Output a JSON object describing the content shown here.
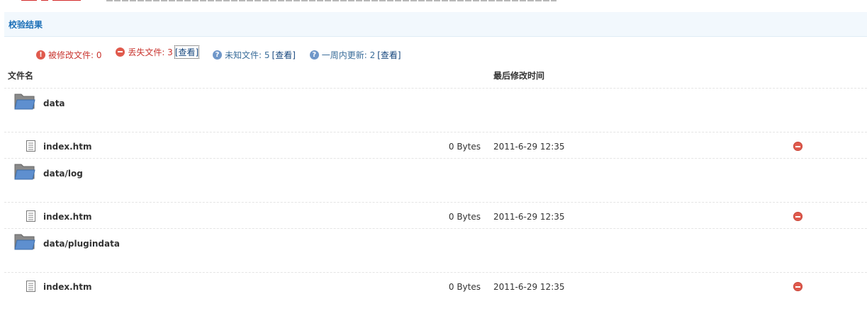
{
  "colors": {
    "accent_blue": "#1b6fb7",
    "header_bg": "#f2f8fd",
    "error_red": "#e05a4d",
    "info_blue": "#6f97c9"
  },
  "section": {
    "title": "校验结果"
  },
  "summary": {
    "modified": {
      "label": "被修改文件: 0",
      "icon": "exclamation-icon"
    },
    "missing": {
      "label": "丢失文件: 3",
      "link": "[查看]",
      "icon": "minus-circle-icon"
    },
    "unknown": {
      "label": "未知文件: 5",
      "link": "[查看]",
      "icon": "question-icon"
    },
    "recent": {
      "label": "一周内更新: 2",
      "link": "[查看]",
      "icon": "question-icon"
    }
  },
  "table": {
    "col_filename": "文件名",
    "col_modified": "最后修改时间",
    "groups": [
      {
        "folder": "data",
        "files": [
          {
            "name": "index.htm",
            "size": "0 Bytes",
            "time": "2011-6-29 12:35"
          }
        ]
      },
      {
        "folder": "data/log",
        "files": [
          {
            "name": "index.htm",
            "size": "0 Bytes",
            "time": "2011-6-29 12:35"
          }
        ]
      },
      {
        "folder": "data/plugindata",
        "files": [
          {
            "name": "index.htm",
            "size": "0 Bytes",
            "time": "2011-6-29 12:35"
          }
        ]
      }
    ]
  }
}
